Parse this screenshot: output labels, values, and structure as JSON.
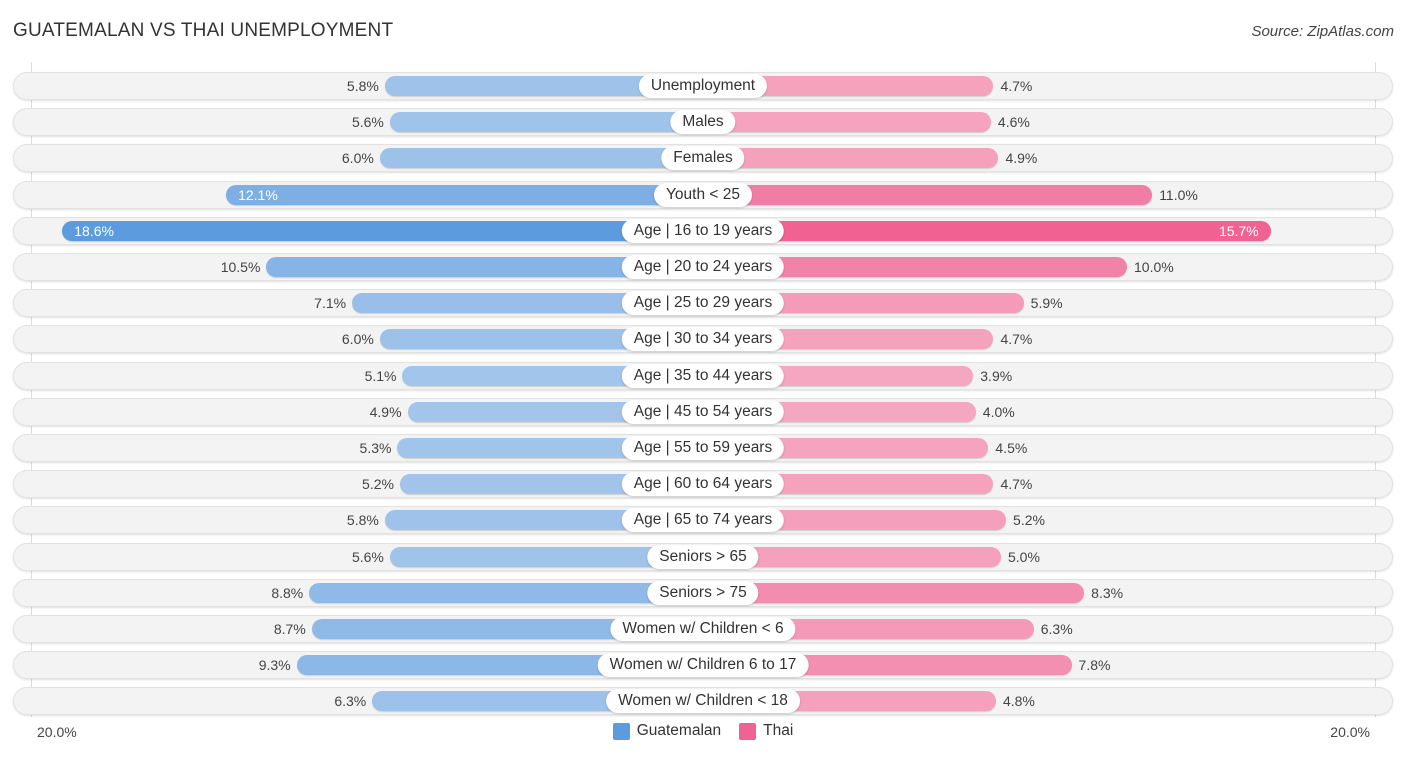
{
  "header": {
    "title": "GUATEMALAN VS THAI UNEMPLOYMENT",
    "source": "Source: ZipAtlas.com"
  },
  "colors": {
    "guatemalan_light": "#a8c8ec",
    "guatemalan_dark": "#5b9bde",
    "thai_light": "#f5a6c0",
    "thai_dark": "#f06292"
  },
  "chart_data": {
    "type": "bar",
    "orientation": "horizontal-diverging",
    "title": "GUATEMALAN VS THAI UNEMPLOYMENT",
    "xlabel": "",
    "ylabel": "",
    "xlim": [
      -20,
      20
    ],
    "axis_tick_labels": {
      "left": "20.0%",
      "right": "20.0%"
    },
    "legend": {
      "position": "bottom-center",
      "entries": [
        "Guatemalan",
        "Thai"
      ]
    },
    "categories": [
      "Unemployment",
      "Males",
      "Females",
      "Youth < 25",
      "Age | 16 to 19 years",
      "Age | 20 to 24 years",
      "Age | 25 to 29 years",
      "Age | 30 to 34 years",
      "Age | 35 to 44 years",
      "Age | 45 to 54 years",
      "Age | 55 to 59 years",
      "Age | 60 to 64 years",
      "Age | 65 to 74 years",
      "Seniors > 65",
      "Seniors > 75",
      "Women w/ Children < 6",
      "Women w/ Children 6 to 17",
      "Women w/ Children < 18"
    ],
    "series": [
      {
        "name": "Guatemalan",
        "side": "left",
        "values": [
          5.8,
          5.6,
          6.0,
          12.1,
          18.6,
          10.5,
          7.1,
          6.0,
          5.1,
          4.9,
          5.3,
          5.2,
          5.8,
          5.6,
          8.8,
          8.7,
          9.3,
          6.3
        ],
        "labels": [
          "5.8%",
          "5.6%",
          "6.0%",
          "12.1%",
          "18.6%",
          "10.5%",
          "7.1%",
          "6.0%",
          "5.1%",
          "4.9%",
          "5.3%",
          "5.2%",
          "5.8%",
          "5.6%",
          "8.8%",
          "8.7%",
          "9.3%",
          "6.3%"
        ]
      },
      {
        "name": "Thai",
        "side": "right",
        "values": [
          4.7,
          4.6,
          4.9,
          11.0,
          15.7,
          10.0,
          5.9,
          4.7,
          3.9,
          4.0,
          4.5,
          4.7,
          5.2,
          5.0,
          8.3,
          6.3,
          7.8,
          4.8
        ],
        "labels": [
          "4.7%",
          "4.6%",
          "4.9%",
          "11.0%",
          "15.7%",
          "10.0%",
          "5.9%",
          "4.7%",
          "3.9%",
          "4.0%",
          "4.5%",
          "4.7%",
          "5.2%",
          "5.0%",
          "8.3%",
          "6.3%",
          "7.8%",
          "4.8%"
        ]
      }
    ]
  }
}
